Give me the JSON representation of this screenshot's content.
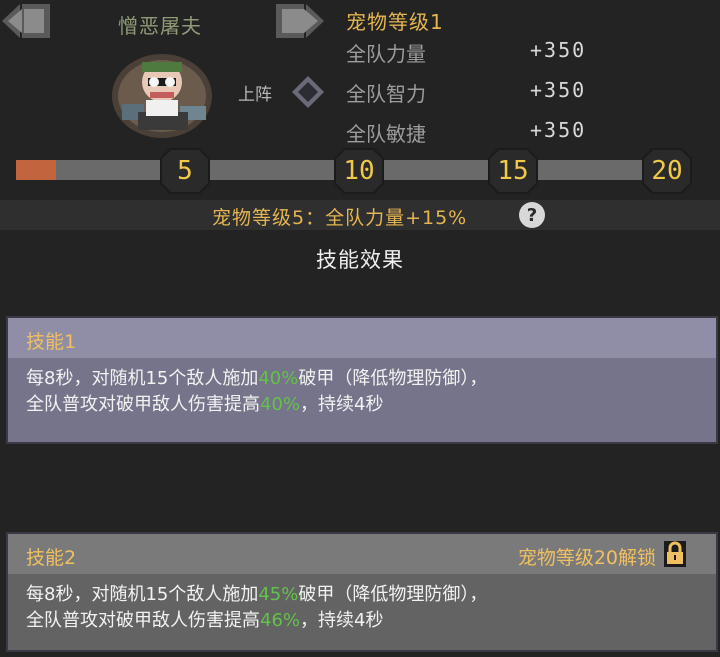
{
  "pet": {
    "name": "憎恶屠夫",
    "deploy_label": "上阵"
  },
  "stats": {
    "title": "宠物等级1",
    "rows": [
      {
        "label": "全队力量",
        "value": "+350"
      },
      {
        "label": "全队智力",
        "value": "+350"
      },
      {
        "label": "全队敏捷",
        "value": "+350"
      }
    ]
  },
  "progress": {
    "current_level": 1,
    "max_level": 20,
    "milestones": [
      "5",
      "10",
      "15",
      "20"
    ]
  },
  "bonus": {
    "text": "宠物等级5：全队力量+15%",
    "help_symbol": "?"
  },
  "section_title": "技能效果",
  "skills": [
    {
      "title": "技能1",
      "line1_a": "每8秒，对随机15个敌人施加",
      "line1_pct": "40%",
      "line1_b": "破甲（降低物理防御），",
      "line2_a": "全队普攻对破甲敌人伤害提高",
      "line2_pct": "40%",
      "line2_b": "，持续4秒"
    },
    {
      "title": "技能2",
      "lock_text": "宠物等级20解锁",
      "line1_a": "每8秒，对随机15个敌人施加",
      "line1_pct": "45%",
      "line1_b": "破甲（降低物理防御），",
      "line2_a": "全队普攻对破甲敌人伤害提高",
      "line2_pct": "46%",
      "line2_b": "，持续4秒"
    }
  ],
  "colors": {
    "accent_gold": "#e5b552",
    "progress_fill": "#c0653e",
    "highlight_green": "#63c24a"
  }
}
